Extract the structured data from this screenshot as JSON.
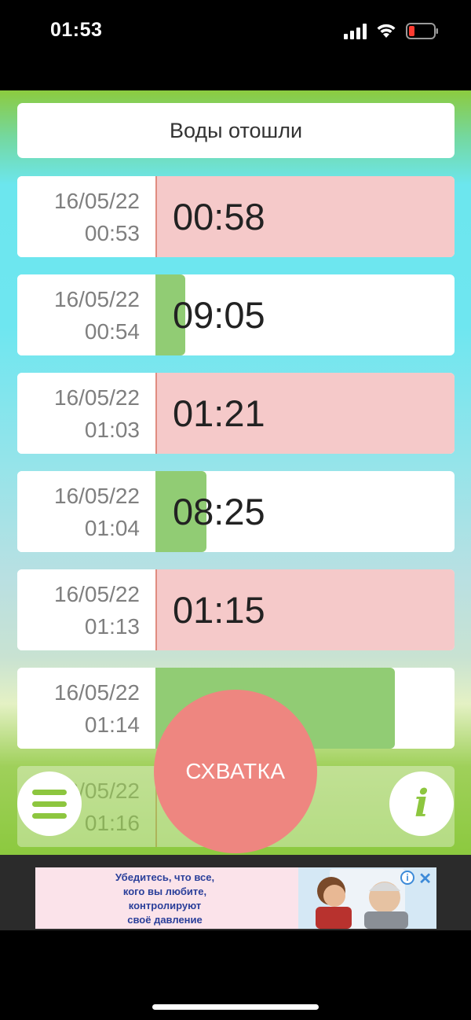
{
  "status_bar": {
    "time": "01:53"
  },
  "header": {
    "label": "Воды отошли"
  },
  "rows": [
    {
      "date": "16/05/22",
      "time": "00:53",
      "duration": "00:58",
      "kind": "pause",
      "fill_fraction": 1.0
    },
    {
      "date": "16/05/22",
      "time": "00:54",
      "duration": "09:05",
      "kind": "contraction",
      "fill_fraction": 0.1
    },
    {
      "date": "16/05/22",
      "time": "01:03",
      "duration": "01:21",
      "kind": "pause",
      "fill_fraction": 1.0
    },
    {
      "date": "16/05/22",
      "time": "01:04",
      "duration": "08:25",
      "kind": "contraction",
      "fill_fraction": 0.17
    },
    {
      "date": "16/05/22",
      "time": "01:13",
      "duration": "01:15",
      "kind": "pause",
      "fill_fraction": 1.0
    },
    {
      "date": "16/05/22",
      "time": "01:14",
      "duration": "",
      "kind": "contraction",
      "fill_fraction": 0.8
    },
    {
      "date": "16/05/22",
      "time": "01:16",
      "duration": "",
      "kind": "pause",
      "fill_fraction": 0.0
    }
  ],
  "main_button": {
    "label": "СХВАТКА"
  },
  "menu_button": {
    "icon": "hamburger-icon"
  },
  "info_button": {
    "icon": "info-icon",
    "glyph": "i"
  },
  "ad": {
    "text_lines": [
      "Убедитесь, что все,",
      "кого вы любите,",
      "контролируют",
      "своё давление"
    ],
    "info_glyph": "i",
    "close_glyph": "✕"
  },
  "colors": {
    "pause": "#f5c9c9",
    "contraction": "#91cc74",
    "main_button": "#ee8680",
    "accent_green": "#8dc63f"
  }
}
